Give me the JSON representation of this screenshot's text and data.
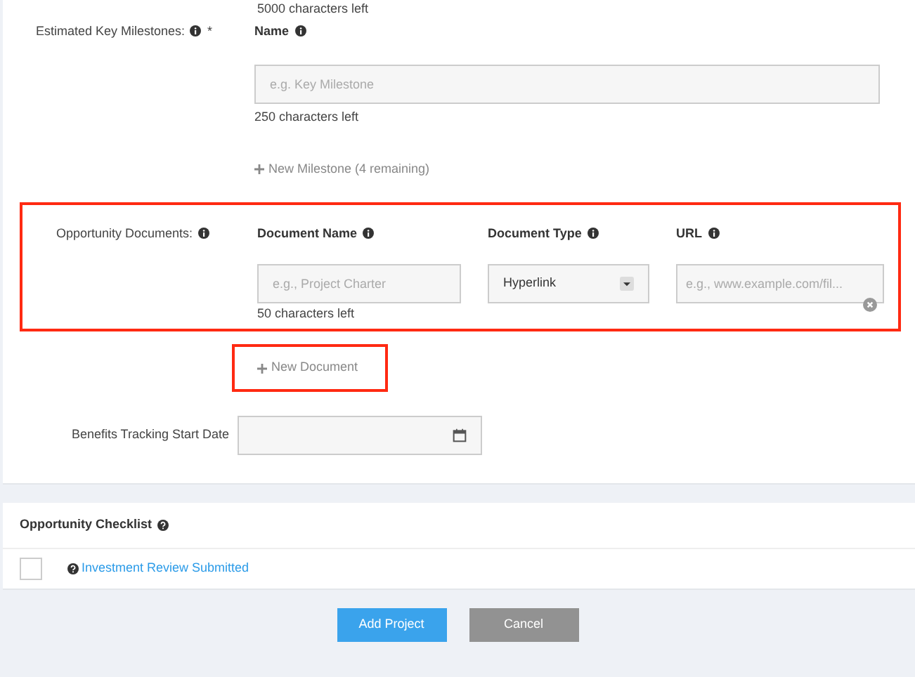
{
  "description_counter": "5000 characters left",
  "milestones": {
    "label": "Estimated Key Milestones:",
    "required_mark": "*",
    "column": "Name",
    "placeholder": "e.g. Key Milestone",
    "counter": "250 characters left",
    "add_link": "New Milestone (4 remaining)"
  },
  "documents": {
    "label": "Opportunity Documents:",
    "highlighted": true,
    "columns": [
      "Document Name",
      "Document Type",
      "URL"
    ],
    "name_placeholder": "e.g., Project Charter",
    "type_value": "Hyperlink",
    "url_placeholder": "e.g., www.example.com/fil...",
    "counter": "50 characters left",
    "add_link": {
      "text": "New Document",
      "highlighted": true
    }
  },
  "benefits": {
    "label": "Benefits Tracking Start Date"
  },
  "checklist": {
    "title": "Opportunity Checklist",
    "items": [
      {
        "text": "Investment Review Submitted",
        "checked": false
      }
    ]
  },
  "buttons": [
    {
      "text": "Add Project",
      "kind": "primary"
    },
    {
      "text": "Cancel",
      "kind": "secondary"
    }
  ]
}
